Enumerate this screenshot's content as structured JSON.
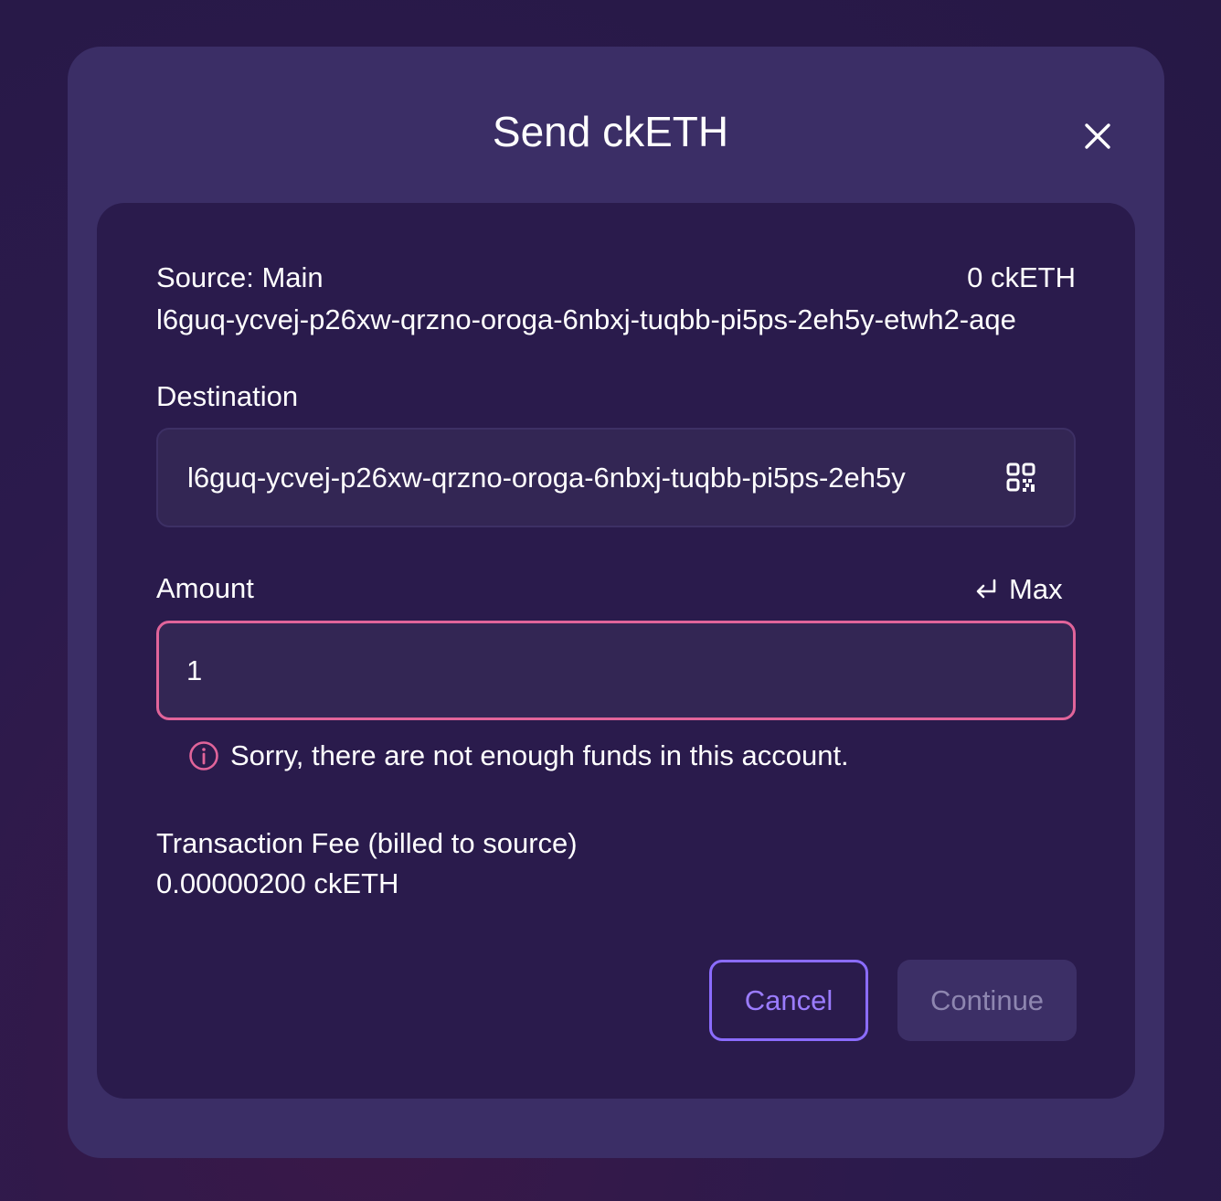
{
  "modal": {
    "title": "Send ckETH"
  },
  "source": {
    "label": "Source: Main",
    "balance": "0 ckETH",
    "address": "l6guq-ycvej-p26xw-qrzno-oroga-6nbxj-tuqbb-pi5ps-2eh5y-etwh2-aqe"
  },
  "destination": {
    "label": "Destination",
    "value": "l6guq-ycvej-p26xw-qrzno-oroga-6nbxj-tuqbb-pi5ps-2eh5y",
    "qr_icon": "qr-code-icon"
  },
  "amount": {
    "label": "Amount",
    "max_label": "Max",
    "value": "1",
    "error": "Sorry, there are not enough funds in this account.",
    "error_color": "#e1649a"
  },
  "fee": {
    "label": "Transaction Fee (billed to source)",
    "value": "0.00000200 ckETH"
  },
  "actions": {
    "cancel_label": "Cancel",
    "continue_label": "Continue",
    "accent": "#8b6cff"
  }
}
